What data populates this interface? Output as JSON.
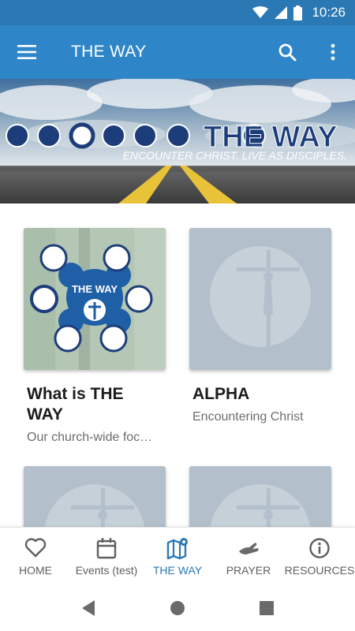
{
  "status_bar": {
    "time": "10:26"
  },
  "app_bar": {
    "title": "THE WAY"
  },
  "banner": {
    "logo_text": "THE WAY",
    "tagline": "ENCOUNTER CHRIST. LIVE AS DISCIPLES."
  },
  "cards": [
    {
      "title": "What is THE WAY",
      "subtitle": "Our church-wide foc…",
      "badge": "THE WAY"
    },
    {
      "title": "ALPHA",
      "subtitle": "Encountering Christ"
    },
    {
      "title": "",
      "subtitle": ""
    },
    {
      "title": "",
      "subtitle": ""
    }
  ],
  "bottom_nav": {
    "items": [
      {
        "label": "HOME",
        "icon": "heart-icon"
      },
      {
        "label": "Events (test)",
        "icon": "calendar-icon"
      },
      {
        "label": "THE WAY",
        "icon": "map-icon"
      },
      {
        "label": "PRAYER",
        "icon": "praying-hands-icon"
      },
      {
        "label": "RESOURCES",
        "icon": "info-icon"
      }
    ],
    "active_index": 2
  },
  "colors": {
    "status_bar": "#2b79b4",
    "app_bar": "#2e86c8",
    "accent": "#2b79b4",
    "placeholder": "#b3c0cb"
  }
}
